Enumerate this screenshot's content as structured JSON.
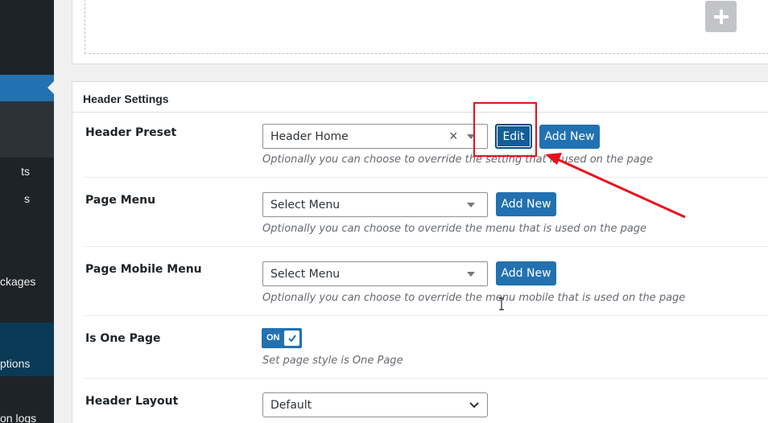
{
  "sidebar": {
    "items": [
      {
        "label": "ts"
      },
      {
        "label": "s"
      },
      {
        "label": "ckages"
      },
      {
        "label": "ptions"
      },
      {
        "label": "on logs"
      }
    ]
  },
  "top_panel": {
    "add_icon": "plus-icon"
  },
  "header_settings": {
    "title": "Header Settings",
    "header_preset": {
      "label": "Header Preset",
      "value": "Header Home",
      "clear_icon": "×",
      "edit_label": "Edit",
      "add_new_label": "Add New",
      "help": "Optionally you can choose to override the setting that is used on the page"
    },
    "page_menu": {
      "label": "Page Menu",
      "value": "Select Menu",
      "add_new_label": "Add New",
      "help": "Optionally you can choose to override the menu that is used on the page"
    },
    "page_mobile_menu": {
      "label": "Page Mobile Menu",
      "value": "Select Menu",
      "add_new_label": "Add New",
      "help": "Optionally you can choose to override the menu mobile that is used on the page"
    },
    "is_one_page": {
      "label": "Is One Page",
      "toggle_text": "ON",
      "toggle_state": true,
      "help": "Set page style is One Page"
    },
    "header_layout": {
      "label": "Header Layout",
      "value": "Default"
    }
  },
  "colors": {
    "accent": "#2271b1",
    "annotation": "#e8101d",
    "sidebar": "#1d2327"
  }
}
